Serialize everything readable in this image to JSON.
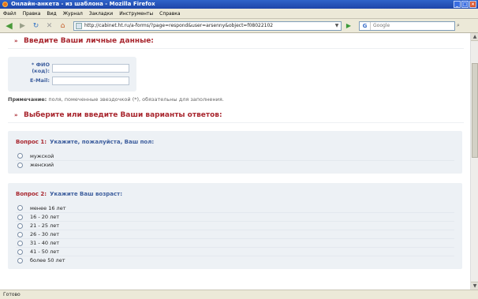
{
  "window": {
    "title": "Онлайн-анкета - из шаблона - Mozilla Firefox"
  },
  "menu": {
    "items": [
      "Файл",
      "Правка",
      "Вид",
      "Журнал",
      "Закладки",
      "Инструменты",
      "Справка"
    ]
  },
  "nav": {
    "url": "http://cabinet.ht.ru/a-forms/?page=respond&user=arsenny&object=f08022102",
    "search_placeholder": "Google"
  },
  "personal": {
    "section_title": "Введите Ваши личные данные:",
    "fio_label": "* ФИО (код):",
    "email_label": "E-Mail:",
    "note_label": "Примечание:",
    "note_text": "поля, помеченные звездочкой (*), обязательны для заполнения."
  },
  "answers": {
    "section_title": "Выберите или введите Ваши варианты ответов:"
  },
  "questions": [
    {
      "number": "Вопрос 1:",
      "text": "Укажите, пожалуйста, Ваш пол:",
      "options": [
        "мужской",
        "женский"
      ]
    },
    {
      "number": "Вопрос 2:",
      "text": "Укажите Ваш возраст:",
      "options": [
        "менее 16 лет",
        "16 - 20 лет",
        "21 - 25 лет",
        "26 - 30 лет",
        "31 - 40 лет",
        "41 - 50 лет",
        "более 50 лет"
      ]
    }
  ],
  "status": {
    "text": "Готово"
  },
  "colors": {
    "accent": "#a8262e",
    "label_blue": "#3e5f9e",
    "panel_bg": "#edf1f5"
  }
}
